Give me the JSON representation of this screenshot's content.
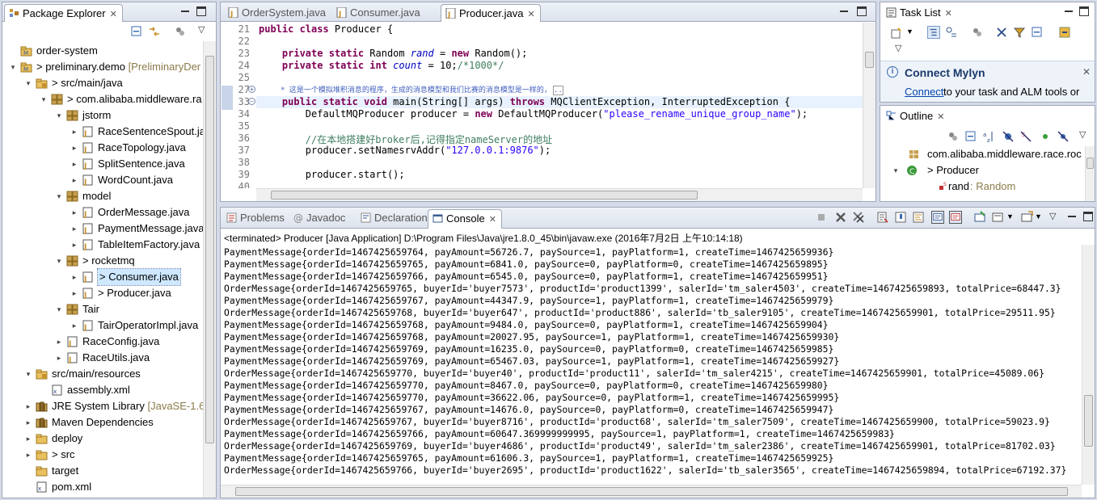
{
  "package_explorer": {
    "title": "Package Explorer",
    "tree": [
      {
        "label": "order-system",
        "suffix": "",
        "depth": 0,
        "icon": "project-icon",
        "twisty": "",
        "selected": false
      },
      {
        "label": "> preliminary.demo",
        "suffix": " [PreliminaryDer",
        "depth": 0,
        "icon": "project-icon",
        "twisty": "▾",
        "selected": false
      },
      {
        "label": "> src/main/java",
        "suffix": "",
        "depth": 1,
        "icon": "source-folder-icon",
        "twisty": "▾",
        "selected": false
      },
      {
        "label": "> com.alibaba.middleware.ra",
        "suffix": "",
        "depth": 2,
        "icon": "package-icon",
        "twisty": "▾",
        "selected": false
      },
      {
        "label": "jstorm",
        "suffix": "",
        "depth": 3,
        "icon": "package-icon",
        "twisty": "▾",
        "selected": false
      },
      {
        "label": "RaceSentenceSpout.jav",
        "suffix": "",
        "depth": 4,
        "icon": "java-file-icon",
        "twisty": "▸",
        "selected": false
      },
      {
        "label": "RaceTopology.java",
        "suffix": "",
        "depth": 4,
        "icon": "java-file-icon",
        "twisty": "▸",
        "selected": false
      },
      {
        "label": "SplitSentence.java",
        "suffix": "",
        "depth": 4,
        "icon": "java-file-icon",
        "twisty": "▸",
        "selected": false
      },
      {
        "label": "WordCount.java",
        "suffix": "",
        "depth": 4,
        "icon": "java-file-icon",
        "twisty": "▸",
        "selected": false
      },
      {
        "label": "model",
        "suffix": "",
        "depth": 3,
        "icon": "package-icon",
        "twisty": "▾",
        "selected": false
      },
      {
        "label": "OrderMessage.java",
        "suffix": "",
        "depth": 4,
        "icon": "java-file-icon",
        "twisty": "▸",
        "selected": false
      },
      {
        "label": "PaymentMessage.java",
        "suffix": "",
        "depth": 4,
        "icon": "java-file-icon",
        "twisty": "▸",
        "selected": false
      },
      {
        "label": "TableItemFactory.java",
        "suffix": "",
        "depth": 4,
        "icon": "java-file-icon",
        "twisty": "▸",
        "selected": false
      },
      {
        "label": "> rocketmq",
        "suffix": "",
        "depth": 3,
        "icon": "package-icon",
        "twisty": "▾",
        "selected": false
      },
      {
        "label": "> Consumer.java",
        "suffix": "",
        "depth": 4,
        "icon": "java-file-icon",
        "twisty": "▸",
        "selected": true
      },
      {
        "label": "> Producer.java",
        "suffix": "",
        "depth": 4,
        "icon": "java-file-icon",
        "twisty": "▸",
        "selected": false
      },
      {
        "label": "Tair",
        "suffix": "",
        "depth": 3,
        "icon": "package-icon",
        "twisty": "▾",
        "selected": false
      },
      {
        "label": "TairOperatorImpl.java",
        "suffix": "",
        "depth": 4,
        "icon": "java-file-icon",
        "twisty": "▸",
        "selected": false
      },
      {
        "label": "RaceConfig.java",
        "suffix": "",
        "depth": 3,
        "icon": "java-file-icon",
        "twisty": "▸",
        "selected": false
      },
      {
        "label": "RaceUtils.java",
        "suffix": "",
        "depth": 3,
        "icon": "java-file-icon",
        "twisty": "▸",
        "selected": false
      },
      {
        "label": "src/main/resources",
        "suffix": "",
        "depth": 1,
        "icon": "source-folder-icon",
        "twisty": "▾",
        "selected": false
      },
      {
        "label": "assembly.xml",
        "suffix": "",
        "depth": 2,
        "icon": "xml-file-icon",
        "twisty": "",
        "selected": false
      },
      {
        "label": "JRE System Library",
        "suffix": " [JavaSE-1.6]",
        "depth": 1,
        "icon": "library-icon",
        "twisty": "▸",
        "selected": false
      },
      {
        "label": "Maven Dependencies",
        "suffix": "",
        "depth": 1,
        "icon": "library-icon",
        "twisty": "▸",
        "selected": false
      },
      {
        "label": "deploy",
        "suffix": "",
        "depth": 1,
        "icon": "folder-icon",
        "twisty": "▸",
        "selected": false
      },
      {
        "label": "> src",
        "suffix": "",
        "depth": 1,
        "icon": "folder-icon",
        "twisty": "▸",
        "selected": false
      },
      {
        "label": "target",
        "suffix": "",
        "depth": 1,
        "icon": "folder-icon",
        "twisty": "",
        "selected": false
      },
      {
        "label": "pom.xml",
        "suffix": "",
        "depth": 1,
        "icon": "xml-file-icon",
        "twisty": "",
        "selected": false
      }
    ]
  },
  "editor": {
    "tabs": [
      {
        "label": "OrderSystem.java",
        "active": false
      },
      {
        "label": "Consumer.java",
        "active": false
      },
      {
        "label": "Producer.java",
        "active": true
      }
    ],
    "lines": [
      {
        "n": "21",
        "html_parts": [
          {
            "t": "public class ",
            "c": "kw"
          },
          {
            "t": "Producer {",
            "c": ""
          }
        ]
      },
      {
        "n": "22",
        "html_parts": []
      },
      {
        "n": "23",
        "html_parts": [
          {
            "t": "    private static ",
            "c": "kw"
          },
          {
            "t": "Random ",
            "c": ""
          },
          {
            "t": "rand",
            "c": "fld"
          },
          {
            "t": " = ",
            "c": ""
          },
          {
            "t": "new ",
            "c": "kw"
          },
          {
            "t": "Random();",
            "c": ""
          }
        ]
      },
      {
        "n": "24",
        "html_parts": [
          {
            "t": "    private static int ",
            "c": "kw"
          },
          {
            "t": "count",
            "c": "fld"
          },
          {
            "t": " = 10;",
            "c": ""
          },
          {
            "t": "/*1000*/",
            "c": "cmt"
          }
        ]
      },
      {
        "n": "25",
        "html_parts": []
      },
      {
        "n": "27",
        "html_parts": [
          {
            "t": "     * 这是一个模拟堆积消息的程序，生成的消息模型和我们比赛的消息模型是一样的，",
            "c": "jd"
          },
          {
            "t": "..",
            "c": "jd"
          }
        ]
      },
      {
        "n": "33",
        "html_parts": [
          {
            "t": "    public static void ",
            "c": "kw"
          },
          {
            "t": "main(String[] args) ",
            "c": ""
          },
          {
            "t": "throws ",
            "c": "kw"
          },
          {
            "t": "MQClientException, InterruptedException {",
            "c": ""
          }
        ]
      },
      {
        "n": "34",
        "html_parts": [
          {
            "t": "        DefaultMQProducer producer = ",
            "c": ""
          },
          {
            "t": "new ",
            "c": "kw"
          },
          {
            "t": "DefaultMQProducer(",
            "c": ""
          },
          {
            "t": "\"please_rename_unique_group_name\"",
            "c": "str"
          },
          {
            "t": ");",
            "c": ""
          }
        ]
      },
      {
        "n": "35",
        "html_parts": []
      },
      {
        "n": "36",
        "html_parts": [
          {
            "t": "        //在本地搭建好broker后,记得指定nameServer的地址",
            "c": "cmt"
          }
        ]
      },
      {
        "n": "37",
        "html_parts": [
          {
            "t": "        producer.setNamesrvAddr(",
            "c": ""
          },
          {
            "t": "\"127.0.0.1:9876\"",
            "c": "str"
          },
          {
            "t": ");",
            "c": ""
          }
        ]
      },
      {
        "n": "38",
        "html_parts": []
      },
      {
        "n": "39",
        "html_parts": [
          {
            "t": "        producer.start();",
            "c": ""
          }
        ]
      },
      {
        "n": "40",
        "html_parts": []
      }
    ]
  },
  "task_list": {
    "title": "Task List",
    "mylyn_title": "Connect Mylyn",
    "mylyn_link": "Connect",
    "mylyn_text": " to your task and ALM tools or"
  },
  "outline": {
    "title": "Outline",
    "items": [
      {
        "label": "com.alibaba.middleware.race.rocl",
        "type": ""
      },
      {
        "label": "> Producer",
        "type": ""
      },
      {
        "label": "rand",
        "type": " : Random"
      }
    ]
  },
  "bottom_tabs": [
    {
      "label": "Problems",
      "active": false,
      "icon": "problems-icon"
    },
    {
      "label": "Javadoc",
      "active": false,
      "icon": "javadoc-icon"
    },
    {
      "label": "Declaration",
      "active": false,
      "icon": "declaration-icon"
    },
    {
      "label": "Console",
      "active": true,
      "icon": "console-icon"
    }
  ],
  "console": {
    "header": "<terminated> Producer [Java Application] D:\\Program Files\\Java\\jre1.8.0_45\\bin\\javaw.exe (2016年7月2日 上午10:14:18)",
    "lines": [
      "PaymentMessage{orderId=1467425659764, payAmount=56726.7, paySource=1, payPlatform=1, createTime=1467425659936}",
      "PaymentMessage{orderId=1467425659765, payAmount=6841.0, paySource=0, payPlatform=0, createTime=1467425659895}",
      "PaymentMessage{orderId=1467425659766, payAmount=6545.0, paySource=0, payPlatform=1, createTime=1467425659951}",
      "OrderMessage{orderId=1467425659765, buyerId='buyer7573', productId='product1399', salerId='tm_saler4503', createTime=1467425659893, totalPrice=68447.3}",
      "PaymentMessage{orderId=1467425659767, payAmount=44347.9, paySource=1, payPlatform=1, createTime=1467425659979}",
      "OrderMessage{orderId=1467425659768, buyerId='buyer647', productId='product886', salerId='tb_saler9105', createTime=1467425659901, totalPrice=29511.95}",
      "PaymentMessage{orderId=1467425659768, payAmount=9484.0, paySource=0, payPlatform=1, createTime=1467425659904}",
      "PaymentMessage{orderId=1467425659768, payAmount=20027.95, paySource=1, payPlatform=1, createTime=1467425659930}",
      "PaymentMessage{orderId=1467425659769, payAmount=16235.0, paySource=0, payPlatform=0, createTime=1467425659985}",
      "PaymentMessage{orderId=1467425659769, payAmount=65467.03, paySource=1, payPlatform=1, createTime=1467425659927}",
      "OrderMessage{orderId=1467425659770, buyerId='buyer40', productId='product11', salerId='tm_saler4215', createTime=1467425659901, totalPrice=45089.06}",
      "PaymentMessage{orderId=1467425659770, payAmount=8467.0, paySource=0, payPlatform=0, createTime=1467425659980}",
      "PaymentMessage{orderId=1467425659770, payAmount=36622.06, paySource=0, payPlatform=1, createTime=1467425659995}",
      "PaymentMessage{orderId=1467425659767, payAmount=14676.0, paySource=0, payPlatform=0, createTime=1467425659947}",
      "OrderMessage{orderId=1467425659767, buyerId='buyer8716', productId='product68', salerId='tm_saler7509', createTime=1467425659900, totalPrice=59023.9}",
      "PaymentMessage{orderId=1467425659766, payAmount=60647.369999999995, paySource=1, payPlatform=1, createTime=1467425659983}",
      "OrderMessage{orderId=1467425659769, buyerId='buyer4686', productId='product49', salerId='tm_saler2386', createTime=1467425659901, totalPrice=81702.03}",
      "PaymentMessage{orderId=1467425659765, payAmount=61606.3, paySource=1, payPlatform=1, createTime=1467425659925}",
      "OrderMessage{orderId=1467425659766, buyerId='buyer2695', productId='product1622', salerId='tb_saler3565', createTime=1467425659894, totalPrice=67192.37}"
    ]
  },
  "colors": {
    "selection": "#cde8ff",
    "current_line": "#e8f2fe",
    "link": "#0645ad"
  }
}
